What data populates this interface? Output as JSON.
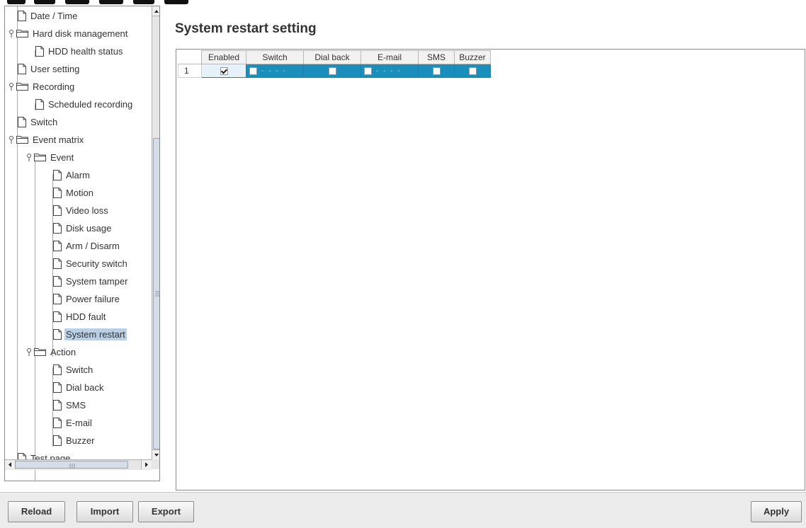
{
  "tree": {
    "items": [
      {
        "label": "Date / Time"
      },
      {
        "label": "Hard disk management"
      },
      {
        "label": "HDD health status"
      },
      {
        "label": "User setting"
      },
      {
        "label": "Recording"
      },
      {
        "label": "Scheduled recording"
      },
      {
        "label": "Switch"
      },
      {
        "label": "Event matrix"
      },
      {
        "label": "Event"
      },
      {
        "label": "Alarm"
      },
      {
        "label": "Motion"
      },
      {
        "label": "Video loss"
      },
      {
        "label": "Disk usage"
      },
      {
        "label": "Arm / Disarm"
      },
      {
        "label": "Security switch"
      },
      {
        "label": "System tamper"
      },
      {
        "label": "Power failure"
      },
      {
        "label": "HDD fault"
      },
      {
        "label": "System restart"
      },
      {
        "label": "Action"
      },
      {
        "label": "Switch"
      },
      {
        "label": "Dial back"
      },
      {
        "label": "SMS"
      },
      {
        "label": "E-mail"
      },
      {
        "label": "Buzzer"
      },
      {
        "label": "Test page"
      }
    ],
    "selected": "System restart"
  },
  "main": {
    "title": "System restart setting",
    "columns": [
      "Enabled",
      "Switch",
      "Dial back",
      "E-mail",
      "SMS",
      "Buzzer"
    ],
    "rows": [
      {
        "num": "1",
        "enabled": true,
        "switch": false,
        "switch_text": "- - - -",
        "dial_back": false,
        "email": false,
        "email_text": "- - - -",
        "sms": false,
        "buzzer": false
      }
    ]
  },
  "buttons": {
    "reload": "Reload",
    "import": "Import",
    "export": "Export",
    "apply": "Apply"
  },
  "colors": {
    "selection_row": "#1a8fbc",
    "tree_selected": "#b8cfe5"
  }
}
